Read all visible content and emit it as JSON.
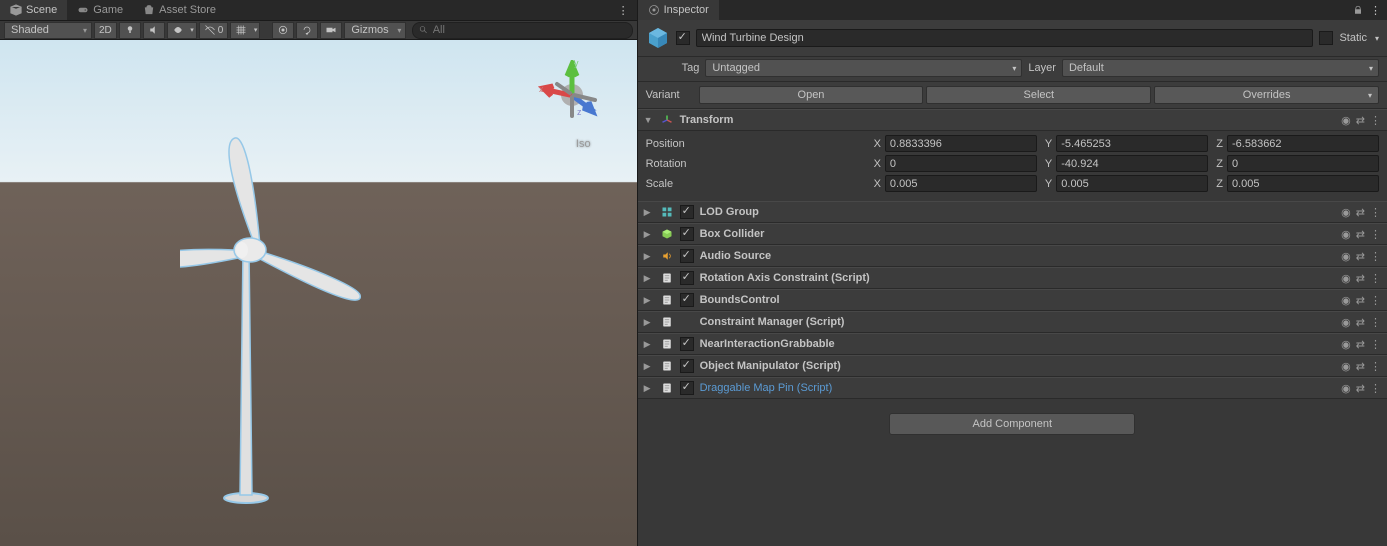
{
  "tabs_left": [
    {
      "label": "Scene",
      "icon": "scene"
    },
    {
      "label": "Game",
      "icon": "game"
    },
    {
      "label": "Asset Store",
      "icon": "store"
    }
  ],
  "tabs_right": [
    {
      "label": "Inspector",
      "icon": "inspector"
    }
  ],
  "scene_toolbar": {
    "shading": "Shaded",
    "mode_2d": "2D",
    "hidden_count": "0",
    "gizmos": "Gizmos",
    "search_placeholder": "All"
  },
  "viewport": {
    "projection": "Iso",
    "axes": {
      "x": "x",
      "y": "y",
      "z": "z"
    }
  },
  "inspector": {
    "enabled": true,
    "name": "Wind Turbine Design",
    "static_label": "Static",
    "tag_label": "Tag",
    "tag_value": "Untagged",
    "layer_label": "Layer",
    "layer_value": "Default",
    "variant_label": "Variant",
    "variant_open": "Open",
    "variant_select": "Select",
    "variant_overrides": "Overrides"
  },
  "transform": {
    "title": "Transform",
    "position_label": "Position",
    "rotation_label": "Rotation",
    "scale_label": "Scale",
    "position": {
      "x": "0.8833396",
      "y": "-5.465253",
      "z": "-6.583662"
    },
    "rotation": {
      "x": "0",
      "y": "-40.924",
      "z": "0"
    },
    "scale": {
      "x": "0.005",
      "y": "0.005",
      "z": "0.005"
    }
  },
  "axes": {
    "x": "X",
    "y": "Y",
    "z": "Z"
  },
  "components": [
    {
      "title": "LOD Group",
      "icon": "lod",
      "checked": true,
      "hasCheck": true
    },
    {
      "title": "Box Collider",
      "icon": "box",
      "checked": true,
      "hasCheck": true
    },
    {
      "title": "Audio Source",
      "icon": "audio",
      "checked": true,
      "hasCheck": true
    },
    {
      "title": "Rotation Axis Constraint (Script)",
      "icon": "script",
      "checked": true,
      "hasCheck": true
    },
    {
      "title": "BoundsControl",
      "icon": "script",
      "checked": true,
      "hasCheck": true
    },
    {
      "title": "Constraint Manager (Script)",
      "icon": "script",
      "checked": false,
      "hasCheck": false
    },
    {
      "title": "NearInteractionGrabbable",
      "icon": "script",
      "checked": true,
      "hasCheck": true
    },
    {
      "title": "Object Manipulator (Script)",
      "icon": "script",
      "checked": true,
      "hasCheck": true
    },
    {
      "title": "Draggable Map Pin (Script)",
      "icon": "script",
      "checked": true,
      "hasCheck": true,
      "link": true
    }
  ],
  "add_component": "Add Component"
}
